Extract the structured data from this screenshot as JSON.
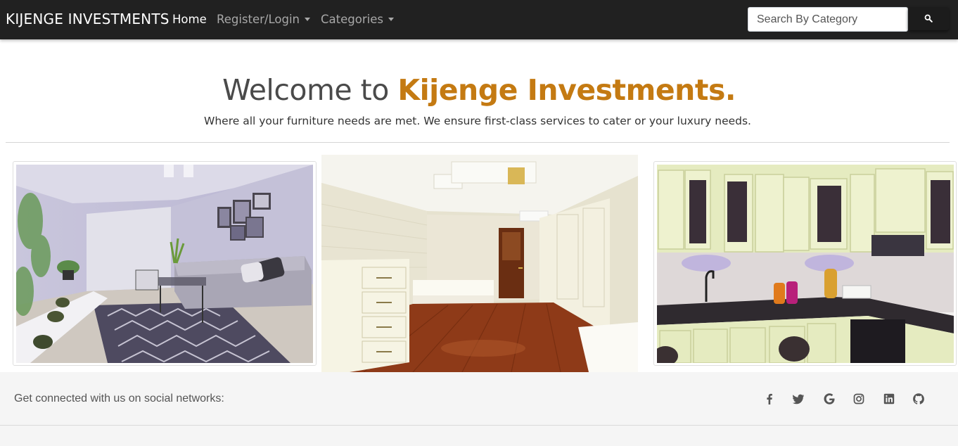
{
  "navbar": {
    "brand": "KIJENGE INVESTMENTS",
    "items": [
      {
        "label": "Home",
        "active": true
      },
      {
        "label": "Register/Login",
        "dropdown": true
      },
      {
        "label": "Categories",
        "dropdown": true
      }
    ],
    "search_placeholder": "Search By Category",
    "search_icon": "search-icon"
  },
  "hero": {
    "title_prefix": "Welcome to ",
    "title_accent": "Kijenge Investments.",
    "subtitle": "Where all your furniture needs are met. We ensure first-class services to cater or your luxury needs.",
    "accent_color": "#c47a12"
  },
  "gallery": [
    {
      "name": "living-room-photo",
      "subject": "living room"
    },
    {
      "name": "bedroom-photo",
      "subject": "bedroom"
    },
    {
      "name": "kitchen-photo",
      "subject": "kitchen"
    }
  ],
  "footer": {
    "connect_text": "Get connected with us on social networks:",
    "social_icons": [
      "facebook-icon",
      "twitter-icon",
      "google-icon",
      "instagram-icon",
      "linkedin-icon",
      "github-icon"
    ]
  },
  "colors": {
    "navbar_bg": "#212121",
    "footer_bg": "#f5f5f5"
  }
}
